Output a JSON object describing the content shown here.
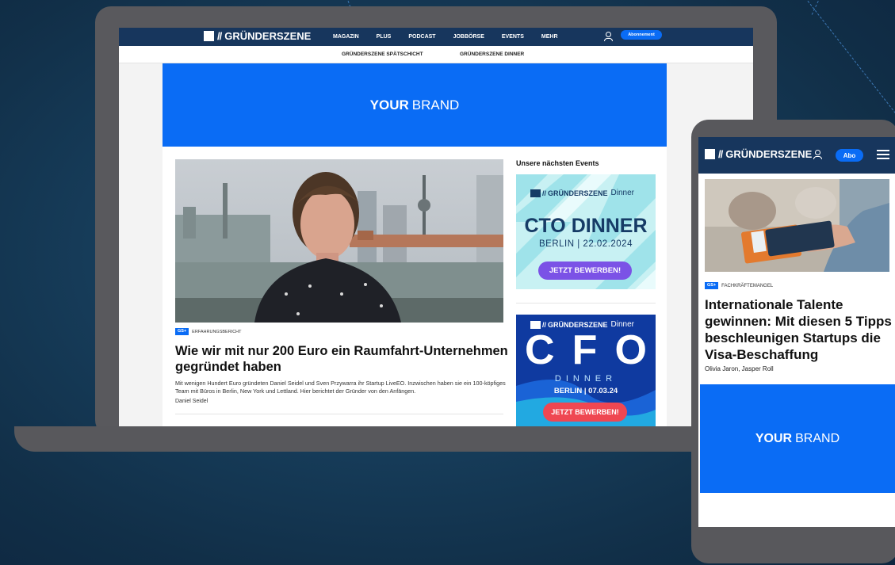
{
  "colors": {
    "nav_bg": "#17365d",
    "accent_blue": "#0a6cf5",
    "device_gray": "#58585c",
    "event1_bg": "#c8f1f3",
    "event1_button": "#7b52e6",
    "event2_bg": "#0f3aa0",
    "event2_button": "#ef4752"
  },
  "laptop": {
    "logo": {
      "slashes": "//",
      "text": "GRÜNDERSZENE"
    },
    "nav_items": [
      "MAGAZIN",
      "PLUS",
      "PODCAST",
      "JOBBÖRSE",
      "EVENTS",
      "MEHR"
    ],
    "user_icon": "user-icon",
    "subscribe_label": "Abonnement",
    "subnav": [
      "GRÜNDERSZENE SPÄTSCHICHT",
      "GRÜNDERSZENE DINNER"
    ],
    "banner": {
      "bold": "YOUR",
      "rest": "BRAND"
    },
    "article": {
      "badge": "GS+",
      "category": "ERFAHRUNGSBERICHT",
      "headline": "Wie wir mit nur 200 Euro ein Raumfahrt-Unternehmen gegründet haben",
      "teaser": "Mit wenigen Hundert Euro gründeten Daniel Seidel und Sven Przywarra ihr Startup LiveEO. Inzwischen haben sie ein 100-köpfiges Team mit Büros in Berlin, New York und Lettland. Hier berichtet der Gründer von den Anfängen.",
      "author": "Daniel Seidel"
    },
    "events": {
      "title": "Unsere nächsten Events",
      "event1": {
        "logo": "GRÜNDERSZENE",
        "logo_suffix": "Dinner",
        "title": "CTO DINNER",
        "date": "BERLIN | 22.02.2024",
        "button": "JETZT BEWERBEN!"
      },
      "event2": {
        "logo": "GRÜNDERSZENE",
        "logo_suffix": "Dinner",
        "letters": [
          "C",
          "F",
          "O"
        ],
        "dinner": "DINNER",
        "date": "BERLIN | 07.03.24",
        "button": "JETZT BEWERBEN!"
      }
    }
  },
  "phone": {
    "logo": {
      "slashes": "//",
      "text": "GRÜNDERSZENE"
    },
    "user_icon": "user-icon",
    "abo_label": "Abo",
    "menu_icon": "hamburger-menu-icon",
    "article": {
      "badge": "GS+",
      "category": "FACHKRÄFTEMANGEL",
      "headline": "Internationale Talente gewinnen: Mit diesen 5 Tipps beschleunigen Startups die Visa-Beschaffung",
      "author": "Olivia Jaron, Jasper Roll"
    },
    "banner": {
      "bold": "YOUR",
      "rest": "BRAND"
    }
  }
}
